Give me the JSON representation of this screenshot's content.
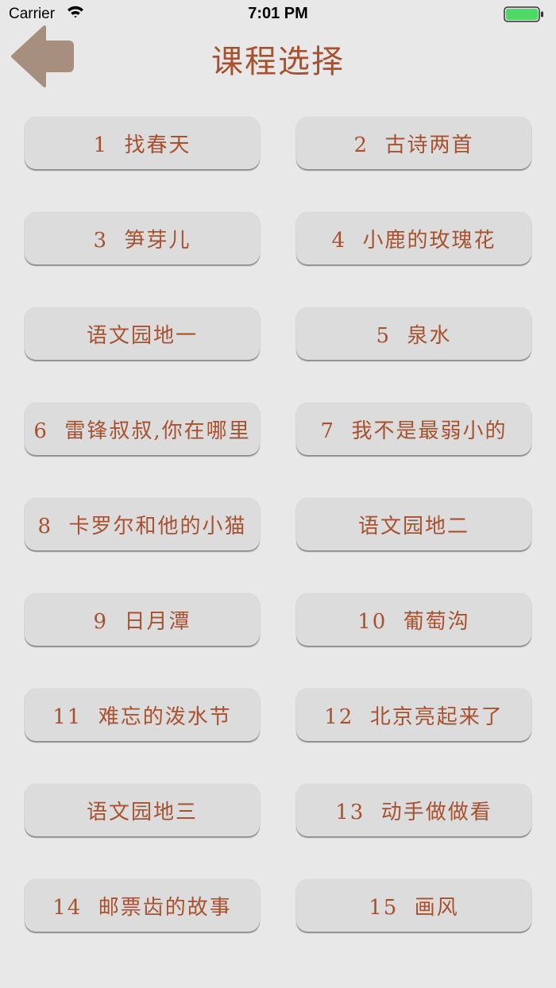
{
  "status_bar": {
    "carrier": "Carrier",
    "time": "7:01 PM",
    "battery_color": "#4cd964"
  },
  "header": {
    "title": "课程选择",
    "back_icon": "arrow-left-icon",
    "back_icon_color": "#a68f7e"
  },
  "accent_color": "#a8512f",
  "lessons": [
    {
      "label": "1  找春天"
    },
    {
      "label": "2  古诗两首"
    },
    {
      "label": "3  笋芽儿"
    },
    {
      "label": "4  小鹿的玫瑰花"
    },
    {
      "label": "语文园地一"
    },
    {
      "label": "5  泉水"
    },
    {
      "label": "6  雷锋叔叔,你在哪里"
    },
    {
      "label": "7  我不是最弱小的"
    },
    {
      "label": "8  卡罗尔和他的小猫"
    },
    {
      "label": "语文园地二"
    },
    {
      "label": "9  日月潭"
    },
    {
      "label": "10  葡萄沟"
    },
    {
      "label": "11  难忘的泼水节"
    },
    {
      "label": "12  北京亮起来了"
    },
    {
      "label": "语文园地三"
    },
    {
      "label": "13  动手做做看"
    },
    {
      "label": "14  邮票齿的故事"
    },
    {
      "label": "15  画风"
    }
  ]
}
